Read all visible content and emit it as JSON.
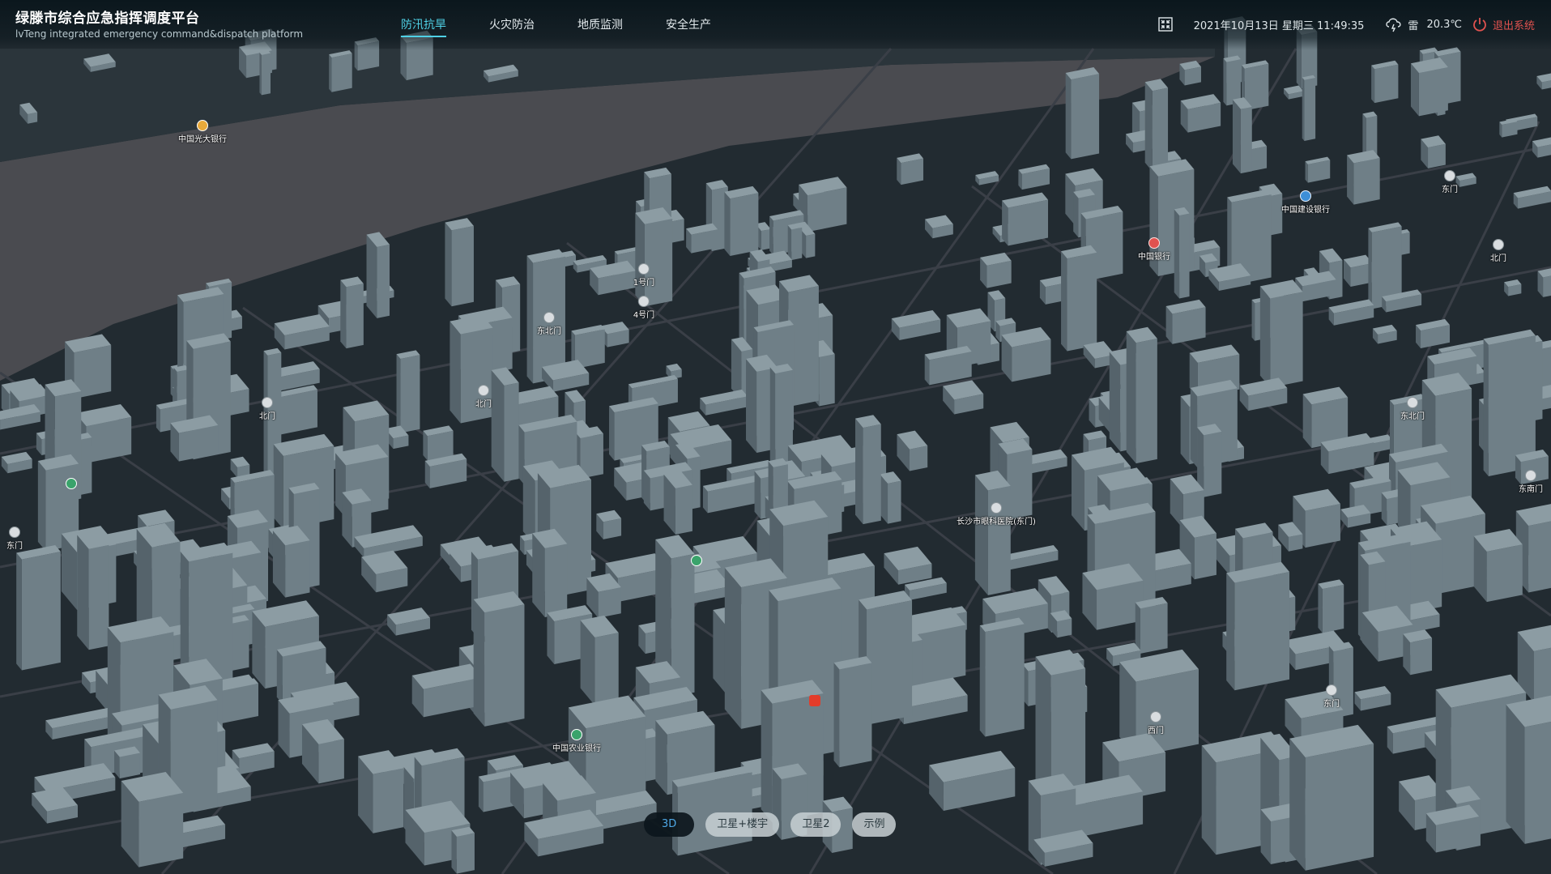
{
  "header": {
    "title": "绿滕市综合应急指挥调度平台",
    "subtitle": "lvTeng integrated emergency command&dispatch platform"
  },
  "nav": {
    "tabs": [
      {
        "label": "防汛抗旱",
        "active": true
      },
      {
        "label": "火灾防治",
        "active": false
      },
      {
        "label": "地质监测",
        "active": false
      },
      {
        "label": "安全生产",
        "active": false
      }
    ]
  },
  "status": {
    "datetime": "2021年10月13日 星期三 11:49:35",
    "weather_text": "雷",
    "temperature": "20.3℃",
    "logout_label": "退出系统",
    "fullscreen_icon": "fullscreen-icon",
    "weather_icon": "thunder-cloud-icon",
    "logout_icon": "power-icon"
  },
  "map_labels": [
    {
      "text": "中国光大银行",
      "kind": "gold"
    },
    {
      "text": "1号门",
      "kind": "gate"
    },
    {
      "text": "4号门",
      "kind": "gate"
    },
    {
      "text": "东北门",
      "kind": "gate"
    },
    {
      "text": "北门",
      "kind": "gate"
    },
    {
      "text": "北门",
      "kind": "gate"
    },
    {
      "text": "东门",
      "kind": "gate"
    },
    {
      "text": "中国建设银行",
      "kind": "bank"
    },
    {
      "text": "东门",
      "kind": "gate"
    },
    {
      "text": "中国银行",
      "kind": "red"
    },
    {
      "text": "北门",
      "kind": "gate"
    },
    {
      "text": "东北门",
      "kind": "gate"
    },
    {
      "text": "东南门",
      "kind": "gate"
    },
    {
      "text": "长沙市眼科医院(东门)",
      "kind": "gate"
    },
    {
      "text": "东门",
      "kind": "gate"
    },
    {
      "text": "西门",
      "kind": "gate"
    },
    {
      "text": "中国农业银行",
      "kind": "green"
    },
    {
      "text": "",
      "kind": "mc"
    },
    {
      "text": "",
      "kind": "green"
    },
    {
      "text": "",
      "kind": "green"
    }
  ],
  "map_controls": [
    {
      "label": "3D",
      "active": true
    },
    {
      "label": "卫星+楼宇",
      "active": false
    },
    {
      "label": "卫星2",
      "active": false
    },
    {
      "label": "示例",
      "active": false
    }
  ],
  "colors": {
    "accent": "#4fd1e6",
    "logout": "#e0524f",
    "building": "#7a8a92",
    "ground": "#232c32",
    "river": "#4a4d52"
  }
}
